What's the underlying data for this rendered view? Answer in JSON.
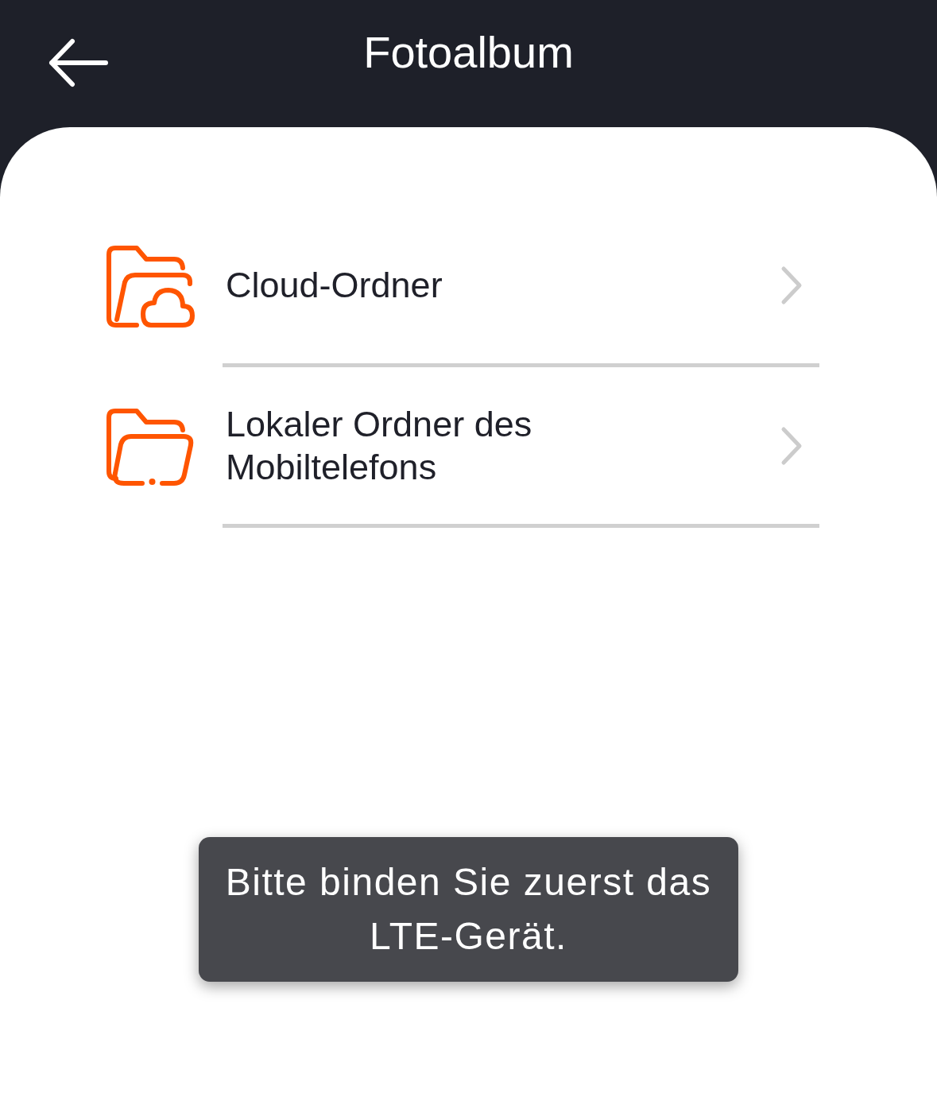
{
  "header": {
    "title": "Fotoalbum"
  },
  "folders": [
    {
      "kind": "cloud",
      "label": "Cloud-Ordner"
    },
    {
      "kind": "local",
      "label": "Lokaler Ordner des Mobiltelefons"
    }
  ],
  "toast": {
    "message": "Bitte binden Sie zuerst das LTE-Gerät."
  }
}
